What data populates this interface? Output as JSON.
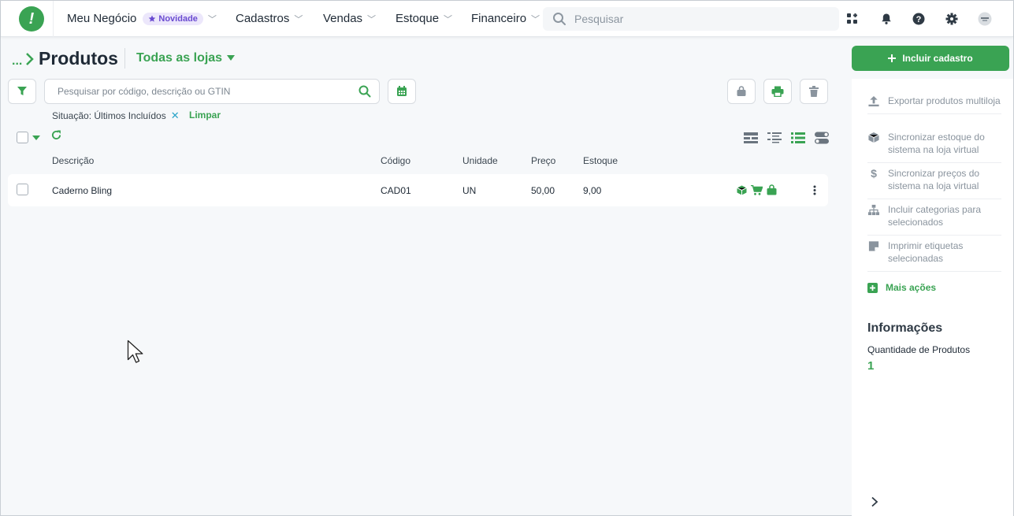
{
  "nav": {
    "items": [
      {
        "label": "Meu Negócio",
        "badge": "Novidade"
      },
      {
        "label": "Cadastros"
      },
      {
        "label": "Vendas"
      },
      {
        "label": "Estoque"
      },
      {
        "label": "Financeiro"
      }
    ],
    "search_placeholder": "Pesquisar",
    "icons": [
      "apps-add-icon",
      "bell-icon",
      "help-icon",
      "gear-icon",
      "avatar"
    ]
  },
  "header": {
    "breadcrumb": "...",
    "title": "Produtos",
    "store_selector": "Todas as lojas",
    "add_button": "Incluir cadastro"
  },
  "filters": {
    "search_placeholder": "Pesquisar por código, descrição ou GTIN",
    "active_filter": "Situação: Últimos Incluídos",
    "clear": "Limpar"
  },
  "table": {
    "columns": [
      "Descrição",
      "Código",
      "Unidade",
      "Preço",
      "Estoque"
    ],
    "rows": [
      {
        "descricao": "Caderno Bling",
        "codigo": "CAD01",
        "unidade": "UN",
        "preco": "50,00",
        "estoque": "9,00"
      }
    ]
  },
  "panel": {
    "actions": [
      {
        "label": "Exportar produtos multiloja",
        "icon": "upload-icon"
      },
      {
        "label": "Sincronizar estoque do sistema na loja virtual",
        "icon": "box-icon"
      },
      {
        "label": "Sincronizar preços do sistema na loja virtual",
        "icon": "dollar-icon"
      },
      {
        "label": "Incluir categorias para selecionados",
        "icon": "hierarchy-icon"
      },
      {
        "label": "Imprimir etiquetas selecionadas",
        "icon": "label-icon"
      }
    ],
    "more": "Mais ações",
    "info_title": "Informações",
    "info_label": "Quantidade de Produtos",
    "info_value": "1"
  },
  "colors": {
    "brand": "#3aa353",
    "badge_bg": "#ece7fb",
    "badge_text": "#6a4bd1"
  }
}
